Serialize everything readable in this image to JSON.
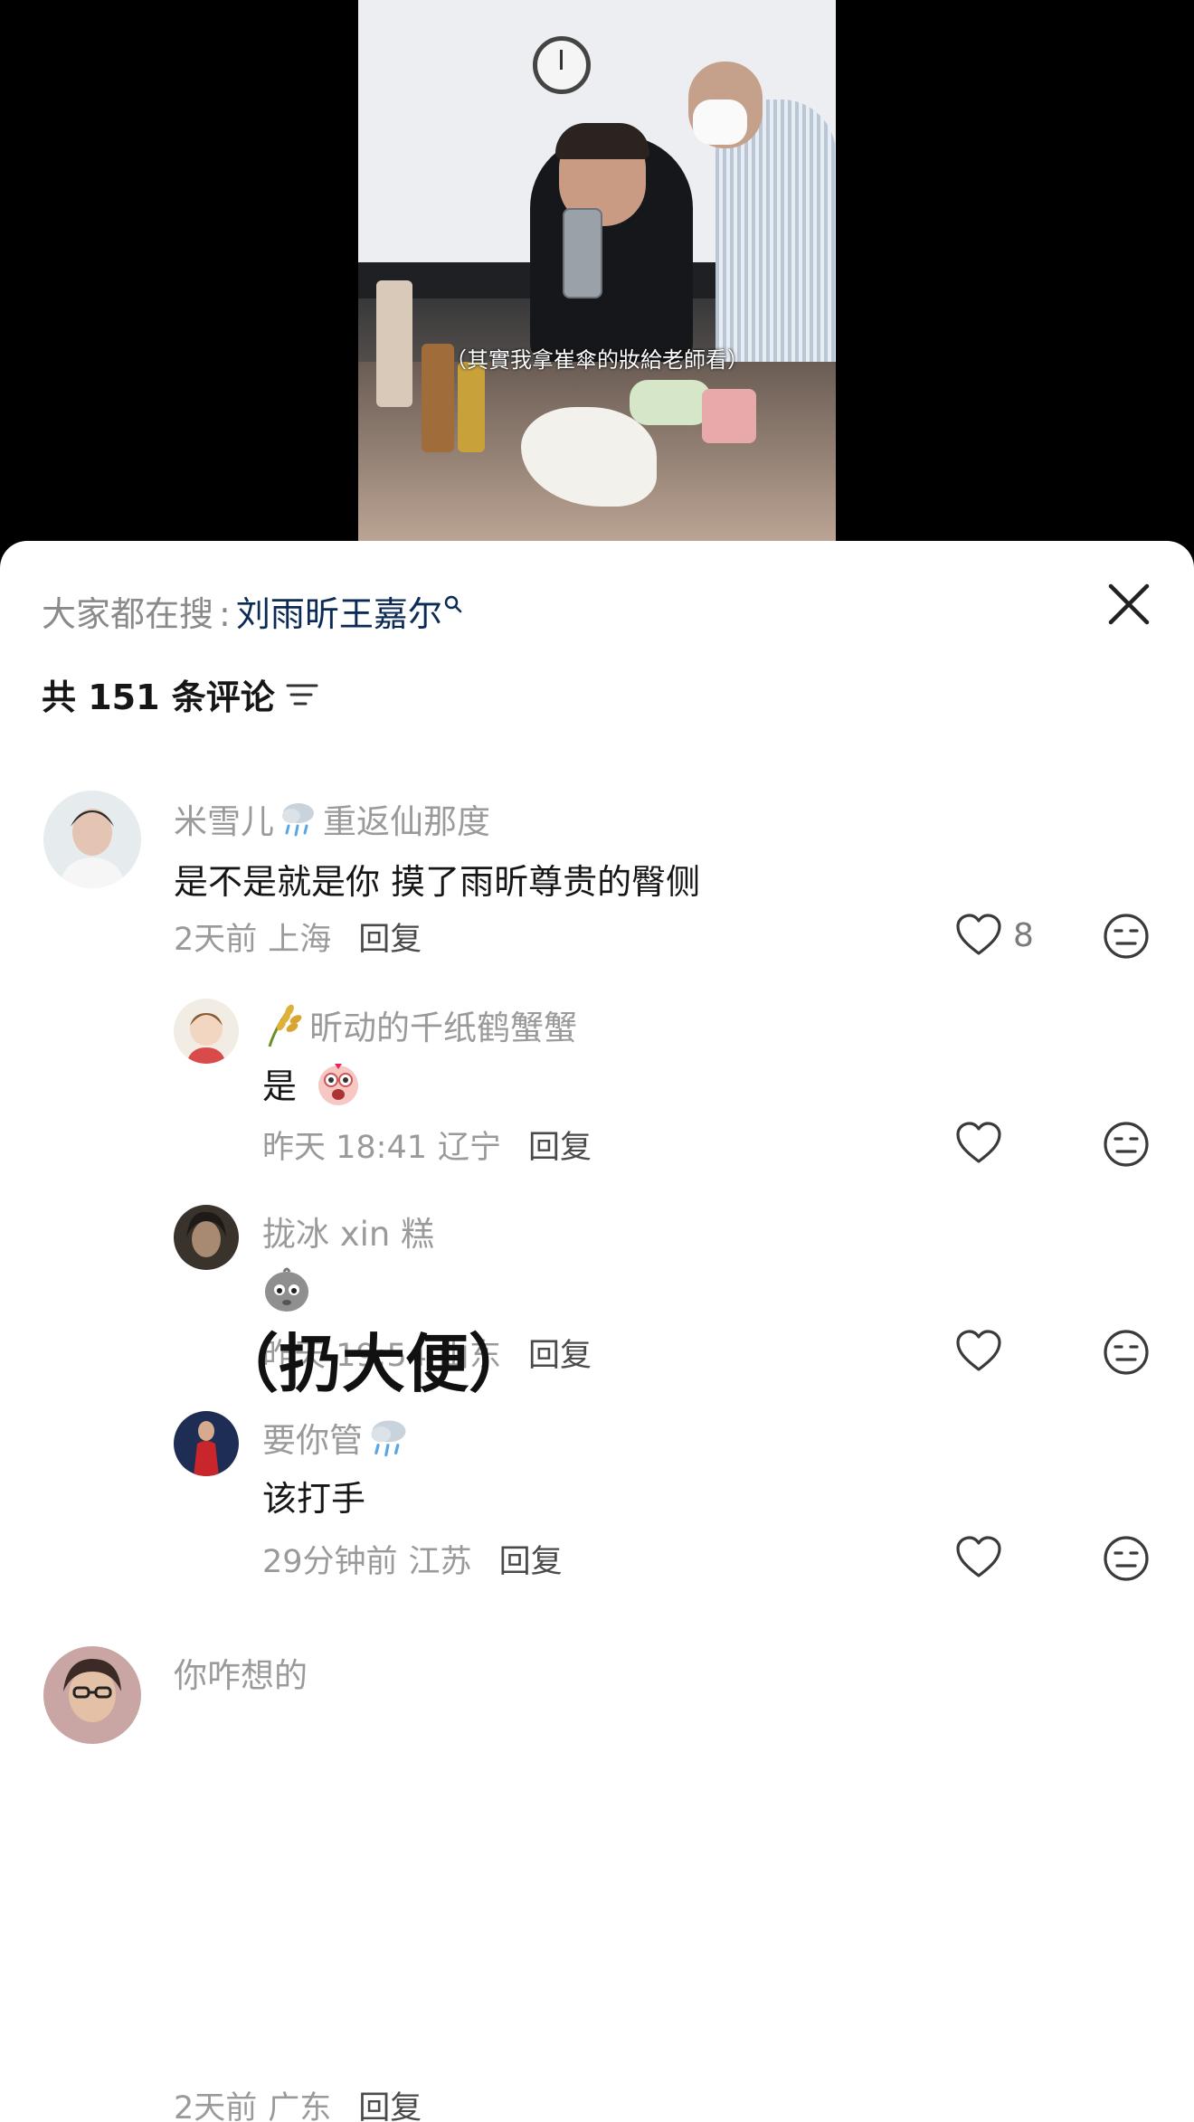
{
  "video": {
    "caption": "（其實我拿崔傘的妝給老師看）"
  },
  "sheet": {
    "search_label": "大家都在搜",
    "search_sep": ":",
    "search_term": "刘雨昕王嘉尔",
    "comment_count_label": "共 151 条评论"
  },
  "comments": [
    {
      "username_a": "米雪儿",
      "username_b": "重返仙那度",
      "text": "是不是就是你 摸了雨昕尊贵的臀侧",
      "time": "2天前",
      "location": "上海",
      "reply": "回复",
      "likes": "8"
    },
    {
      "username": "昕动的千纸鹤蟹蟹",
      "text": "是",
      "time": "昨天 18:41",
      "location": "辽宁",
      "reply": "回复"
    },
    {
      "username": "拢冰 xin 糕",
      "time": "昨天 19:54",
      "location": "山东",
      "reply": "回复"
    },
    {
      "username": "要你管",
      "text": "该打手",
      "time": "29分钟前",
      "location": "江苏",
      "reply": "回复"
    },
    {
      "username": "你咋想的",
      "image_text": "（扔大便）",
      "time": "2天前",
      "location": "广东",
      "reply": "回复"
    }
  ],
  "icons": {
    "close": "close-icon",
    "sort": "sort-icon",
    "like": "heart-icon",
    "dislike": "dislike-face-icon",
    "weather": "rain-cloud-icon",
    "rice": "rice-ear-icon",
    "scream": "scream-face-emoji",
    "sad": "sad-emoji"
  }
}
